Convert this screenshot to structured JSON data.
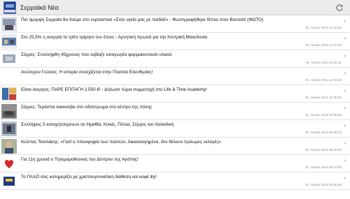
{
  "app": {
    "title": "Σερραϊκά Νέα",
    "icon": "newspaper-logo-icon",
    "refresh_icon": "refresh-icon"
  },
  "news": [
    {
      "title": "Πιο όμορφη Σερραία θα δούμε στο εορταστικό «Στην υγεία μας ρε παιδιά!» - Φωτογραφήθηκε δίπλα στον Βουτσά! (ΦΩΤΟ)",
      "date": "Πε, 18 Δεκ 2014 11:41:40"
    },
    {
      "title": "Στο 25,5% η ανεργία το τρίτο τρίμηνο του έτους - Αρνητική πρωτιά για την Κεντρική Μακεδονία",
      "date": "Πε, 18 Δεκ 2014 11:37:40"
    },
    {
      "title": "Σέρρες: Συνελήφθη 45χρονος που εκβίαζε εισαγωγέα φαρμακευτικού υλικού",
      "date": "Πε, 18 Δεκ 2014 11:30:11"
    },
    {
      "title": "Ανώτερον Γεύσεις: Η ιστορία συνεχίζεται στην Πλατεία Ελευθερίας!",
      "date": "Πε, 18 Δεκ 2014 11:03:18"
    },
    {
      "title": "Είσαι άνεργος; ΠΑΡΕ ΕΠΙΤΑΓΗ 2.550 €! - Δήλωσε τώρα συμμετοχή στο Life & Time Academy!",
      "date": "Πε, 18 Δεκ 2014 10:45:22"
    },
    {
      "title": "Σέρρες: Τεράστια λακκούβα στο οδόστρωμα στο κέντρο της πόλης",
      "date": "Πε, 18 Δεκ 2014 10:06:26"
    },
    {
      "title": "Συλλήψεις 5 κατοχητούμενων σε Ημαθία, Κιλκίς, Πέλλα, Σέρρες και Χαλκιδική",
      "date": "Πε, 18 Δεκ 2014 09:46:14"
    },
    {
      "title": "Κώστας Τασιλάκης: «Γιατί η πλειοψηφία των πολιτών, δικαιολογημένα, δεν θέλουν πρόωρες εκλογές»",
      "date": "Πε, 18 Δεκ 2014 09:40:29"
    },
    {
      "title": "Για 11η χρονιά ο Τηλεμαραθώνιος του Δέντρου της Αγάπης!",
      "date": "Πε, 18 Δεκ 2014 09:34:00"
    },
    {
      "title": "Το ΓΚΑΖΙ σας καλημερίζει με χριστουγεννιάτικη διάθεση και καφέ illy!",
      "date": "Πε, 18 Δεκ 2014 08:45:06"
    }
  ]
}
